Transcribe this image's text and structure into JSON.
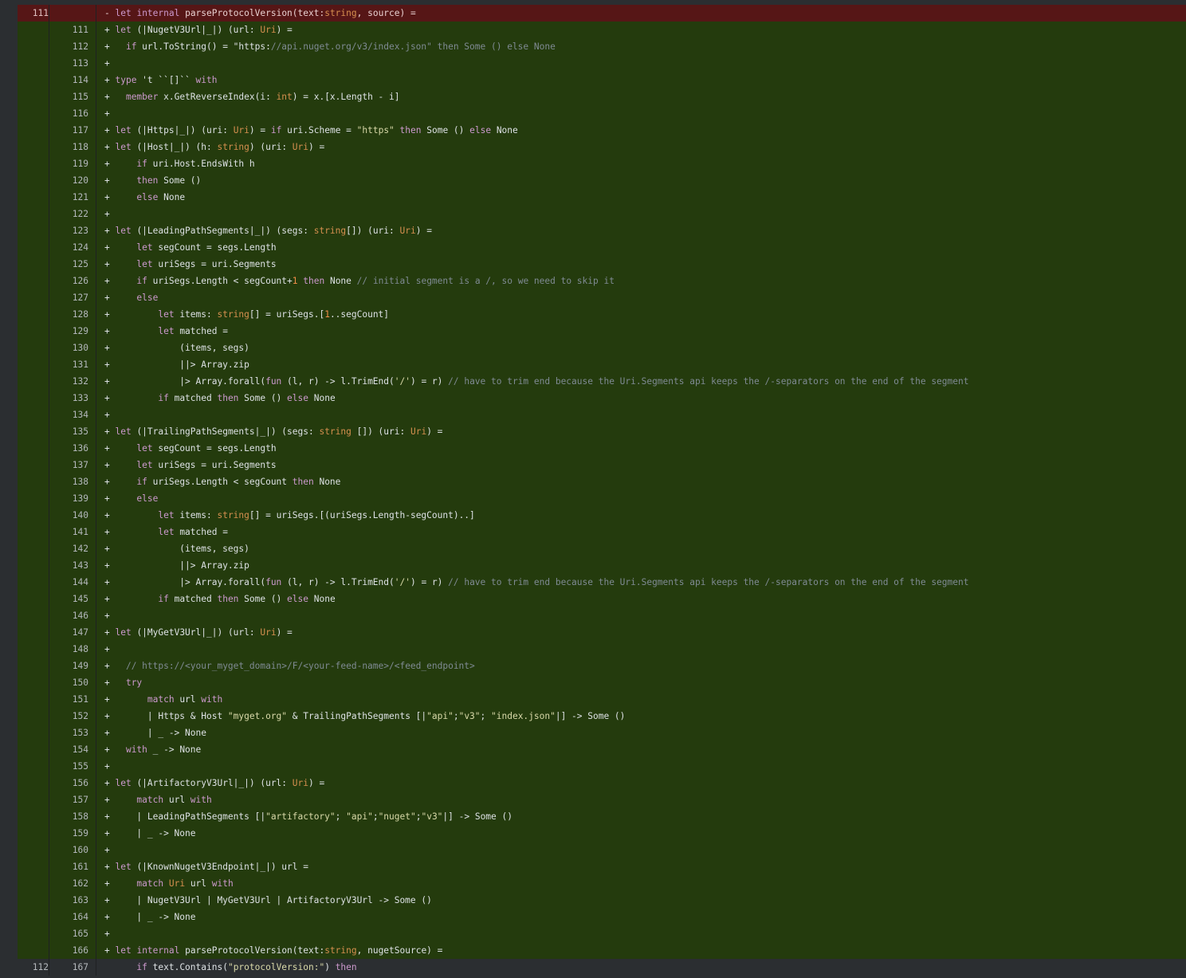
{
  "diff": {
    "lines": [
      {
        "type": "del",
        "old": "111",
        "new": "",
        "code": "- let internal parseProtocolVersion(text:string, source) ="
      },
      {
        "type": "add",
        "old": "",
        "new": "111",
        "code": "+ let (|NugetV3Url|_|) (url: Uri) ="
      },
      {
        "type": "add",
        "old": "",
        "new": "112",
        "code": "+   if url.ToString() = \"https://api.nuget.org/v3/index.json\" then Some () else None"
      },
      {
        "type": "add",
        "old": "",
        "new": "113",
        "code": "+"
      },
      {
        "type": "add",
        "old": "",
        "new": "114",
        "code": "+ type 't ``[]`` with"
      },
      {
        "type": "add",
        "old": "",
        "new": "115",
        "code": "+   member x.GetReverseIndex(i: int) = x.[x.Length - i]"
      },
      {
        "type": "add",
        "old": "",
        "new": "116",
        "code": "+"
      },
      {
        "type": "add",
        "old": "",
        "new": "117",
        "code": "+ let (|Https|_|) (uri: Uri) = if uri.Scheme = \"https\" then Some () else None"
      },
      {
        "type": "add",
        "old": "",
        "new": "118",
        "code": "+ let (|Host|_|) (h: string) (uri: Uri) ="
      },
      {
        "type": "add",
        "old": "",
        "new": "119",
        "code": "+     if uri.Host.EndsWith h"
      },
      {
        "type": "add",
        "old": "",
        "new": "120",
        "code": "+     then Some ()"
      },
      {
        "type": "add",
        "old": "",
        "new": "121",
        "code": "+     else None"
      },
      {
        "type": "add",
        "old": "",
        "new": "122",
        "code": "+"
      },
      {
        "type": "add",
        "old": "",
        "new": "123",
        "code": "+ let (|LeadingPathSegments|_|) (segs: string[]) (uri: Uri) ="
      },
      {
        "type": "add",
        "old": "",
        "new": "124",
        "code": "+     let segCount = segs.Length"
      },
      {
        "type": "add",
        "old": "",
        "new": "125",
        "code": "+     let uriSegs = uri.Segments"
      },
      {
        "type": "add",
        "old": "",
        "new": "126",
        "code": "+     if uriSegs.Length < segCount+1 then None // initial segment is a /, so we need to skip it"
      },
      {
        "type": "add",
        "old": "",
        "new": "127",
        "code": "+     else"
      },
      {
        "type": "add",
        "old": "",
        "new": "128",
        "code": "+         let items: string[] = uriSegs.[1..segCount]"
      },
      {
        "type": "add",
        "old": "",
        "new": "129",
        "code": "+         let matched ="
      },
      {
        "type": "add",
        "old": "",
        "new": "130",
        "code": "+             (items, segs)"
      },
      {
        "type": "add",
        "old": "",
        "new": "131",
        "code": "+             ||> Array.zip"
      },
      {
        "type": "add",
        "old": "",
        "new": "132",
        "code": "+             |> Array.forall(fun (l, r) -> l.TrimEnd('/') = r) // have to trim end because the Uri.Segments api keeps the /-separators on the end of the segment"
      },
      {
        "type": "add",
        "old": "",
        "new": "133",
        "code": "+         if matched then Some () else None"
      },
      {
        "type": "add",
        "old": "",
        "new": "134",
        "code": "+"
      },
      {
        "type": "add",
        "old": "",
        "new": "135",
        "code": "+ let (|TrailingPathSegments|_|) (segs: string []) (uri: Uri) ="
      },
      {
        "type": "add",
        "old": "",
        "new": "136",
        "code": "+     let segCount = segs.Length"
      },
      {
        "type": "add",
        "old": "",
        "new": "137",
        "code": "+     let uriSegs = uri.Segments"
      },
      {
        "type": "add",
        "old": "",
        "new": "138",
        "code": "+     if uriSegs.Length < segCount then None"
      },
      {
        "type": "add",
        "old": "",
        "new": "139",
        "code": "+     else"
      },
      {
        "type": "add",
        "old": "",
        "new": "140",
        "code": "+         let items: string[] = uriSegs.[(uriSegs.Length-segCount)..]"
      },
      {
        "type": "add",
        "old": "",
        "new": "141",
        "code": "+         let matched ="
      },
      {
        "type": "add",
        "old": "",
        "new": "142",
        "code": "+             (items, segs)"
      },
      {
        "type": "add",
        "old": "",
        "new": "143",
        "code": "+             ||> Array.zip"
      },
      {
        "type": "add",
        "old": "",
        "new": "144",
        "code": "+             |> Array.forall(fun (l, r) -> l.TrimEnd('/') = r) // have to trim end because the Uri.Segments api keeps the /-separators on the end of the segment"
      },
      {
        "type": "add",
        "old": "",
        "new": "145",
        "code": "+         if matched then Some () else None"
      },
      {
        "type": "add",
        "old": "",
        "new": "146",
        "code": "+"
      },
      {
        "type": "add",
        "old": "",
        "new": "147",
        "code": "+ let (|MyGetV3Url|_|) (url: Uri) ="
      },
      {
        "type": "add",
        "old": "",
        "new": "148",
        "code": "+"
      },
      {
        "type": "add",
        "old": "",
        "new": "149",
        "code": "+   // https://<your_myget_domain>/F/<your-feed-name>/<feed_endpoint>"
      },
      {
        "type": "add",
        "old": "",
        "new": "150",
        "code": "+   try"
      },
      {
        "type": "add",
        "old": "",
        "new": "151",
        "code": "+       match url with"
      },
      {
        "type": "add",
        "old": "",
        "new": "152",
        "code": "+       | Https & Host \"myget.org\" & TrailingPathSegments [|\"api\";\"v3\"; \"index.json\"|] -> Some ()"
      },
      {
        "type": "add",
        "old": "",
        "new": "153",
        "code": "+       | _ -> None"
      },
      {
        "type": "add",
        "old": "",
        "new": "154",
        "code": "+   with _ -> None"
      },
      {
        "type": "add",
        "old": "",
        "new": "155",
        "code": "+"
      },
      {
        "type": "add",
        "old": "",
        "new": "156",
        "code": "+ let (|ArtifactoryV3Url|_|) (url: Uri) ="
      },
      {
        "type": "add",
        "old": "",
        "new": "157",
        "code": "+     match url with"
      },
      {
        "type": "add",
        "old": "",
        "new": "158",
        "code": "+     | LeadingPathSegments [|\"artifactory\"; \"api\";\"nuget\";\"v3\"|] -> Some ()"
      },
      {
        "type": "add",
        "old": "",
        "new": "159",
        "code": "+     | _ -> None"
      },
      {
        "type": "add",
        "old": "",
        "new": "160",
        "code": "+"
      },
      {
        "type": "add",
        "old": "",
        "new": "161",
        "code": "+ let (|KnownNugetV3Endpoint|_|) url ="
      },
      {
        "type": "add",
        "old": "",
        "new": "162",
        "code": "+     match Uri url with"
      },
      {
        "type": "add",
        "old": "",
        "new": "163",
        "code": "+     | NugetV3Url | MyGetV3Url | ArtifactoryV3Url -> Some ()"
      },
      {
        "type": "add",
        "old": "",
        "new": "164",
        "code": "+     | _ -> None"
      },
      {
        "type": "add",
        "old": "",
        "new": "165",
        "code": "+"
      },
      {
        "type": "add",
        "old": "",
        "new": "166",
        "code": "+ let internal parseProtocolVersion(text:string, nugetSource) ="
      },
      {
        "type": "ctx",
        "old": "112",
        "new": "167",
        "code": "      if text.Contains(\"protocolVersion:\") then"
      }
    ]
  }
}
